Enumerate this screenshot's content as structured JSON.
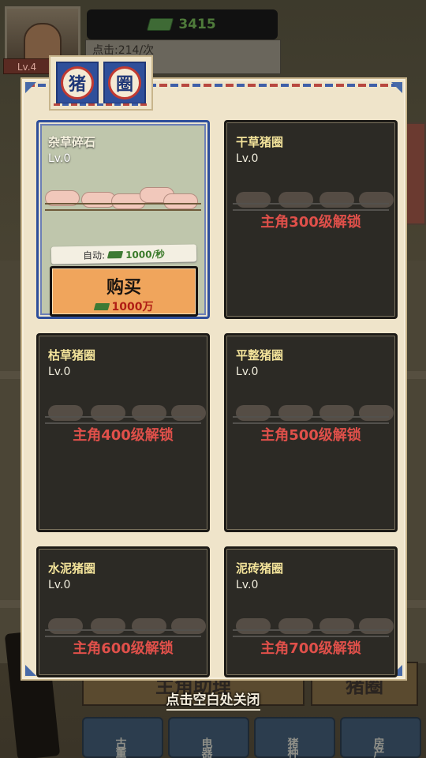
{
  "hud": {
    "level": "Lv.4",
    "money": "3415",
    "click_rate": "点击:214/次"
  },
  "panel": {
    "title_chars": [
      "猪",
      "圈"
    ],
    "cards": [
      {
        "name": "杂草碎石",
        "level": "Lv.0",
        "auto_label": "自动:",
        "auto_rate": "1000/秒",
        "buy_label": "购买",
        "buy_cost": "1000万"
      },
      {
        "name": "干草猪圈",
        "level": "Lv.0",
        "lock_text": "主角300级解锁"
      },
      {
        "name": "枯草猪圈",
        "level": "Lv.0",
        "lock_text": "主角400级解锁"
      },
      {
        "name": "平整猪圈",
        "level": "Lv.0",
        "lock_text": "主角500级解锁"
      },
      {
        "name": "水泥猪圈",
        "level": "Lv.0",
        "lock_text": "主角600级解锁"
      },
      {
        "name": "泥砖猪圈",
        "level": "Lv.0",
        "lock_text": "主角700级解锁"
      }
    ]
  },
  "close_hint": "点击空白处关闭",
  "background_buttons": {
    "left": "主角助理",
    "right": "猪圈"
  },
  "tabs": [
    "古董",
    "电器",
    "猪种",
    "房产"
  ],
  "colors": {
    "accent_blue": "#2f4f9a",
    "accent_red": "#c03a32",
    "lock_text": "#e0504a",
    "buy_button": "#f0a55c",
    "panel_bg": "#efe4ca"
  }
}
